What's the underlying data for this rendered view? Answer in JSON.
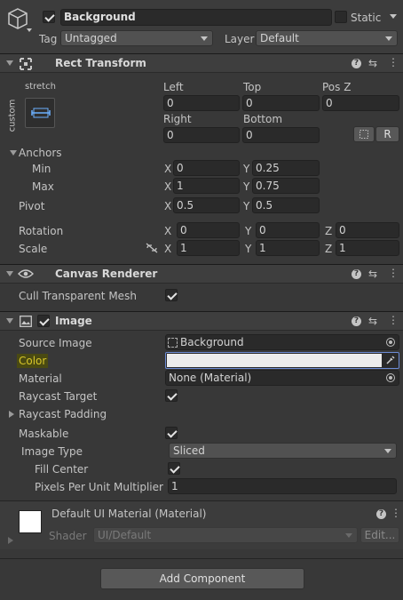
{
  "go": {
    "name": "Background",
    "static_label": "Static",
    "tag_label": "Tag",
    "tag_value": "Untagged",
    "layer_label": "Layer",
    "layer_value": "Default"
  },
  "rect": {
    "title": "Rect Transform",
    "anchor_preset": "stretch",
    "anchor_preset_side": "custom",
    "left_label": "Left",
    "left": "0",
    "top_label": "Top",
    "top": "0",
    "posz_label": "Pos Z",
    "posz": "0",
    "right_label": "Right",
    "right": "0",
    "bottom_label": "Bottom",
    "bottom": "0",
    "r_btn": "R",
    "anchors_label": "Anchors",
    "min_label": "Min",
    "min_x": "0",
    "min_y": "0.25",
    "max_label": "Max",
    "max_x": "1",
    "max_y": "0.75",
    "pivot_label": "Pivot",
    "pivot_x": "0.5",
    "pivot_y": "0.5",
    "rotation_label": "Rotation",
    "rot_x": "0",
    "rot_y": "0",
    "rot_z": "0",
    "scale_label": "Scale",
    "scale_x": "1",
    "scale_y": "1",
    "scale_z": "1",
    "x": "X",
    "y": "Y",
    "z": "Z"
  },
  "canvas": {
    "title": "Canvas Renderer",
    "cull_label": "Cull Transparent Mesh",
    "cull": true
  },
  "image": {
    "title": "Image",
    "enabled": true,
    "source_label": "Source Image",
    "source_value": "Background",
    "color_label": "Color",
    "color_value": "#ececec",
    "color_label_highlight": "#4a4a12",
    "material_label": "Material",
    "material_value": "None (Material)",
    "raycast_label": "Raycast Target",
    "raycast": true,
    "padding_label": "Raycast Padding",
    "maskable_label": "Maskable",
    "maskable": true,
    "type_label": "Image Type",
    "type_value": "Sliced",
    "fill_label": "Fill Center",
    "fill": true,
    "ppu_label": "Pixels Per Unit Multiplier",
    "ppu": "1"
  },
  "material": {
    "title": "Default UI Material (Material)",
    "shader_label": "Shader",
    "shader_value": "UI/Default",
    "edit_label": "Edit..."
  },
  "add_component": "Add Component"
}
